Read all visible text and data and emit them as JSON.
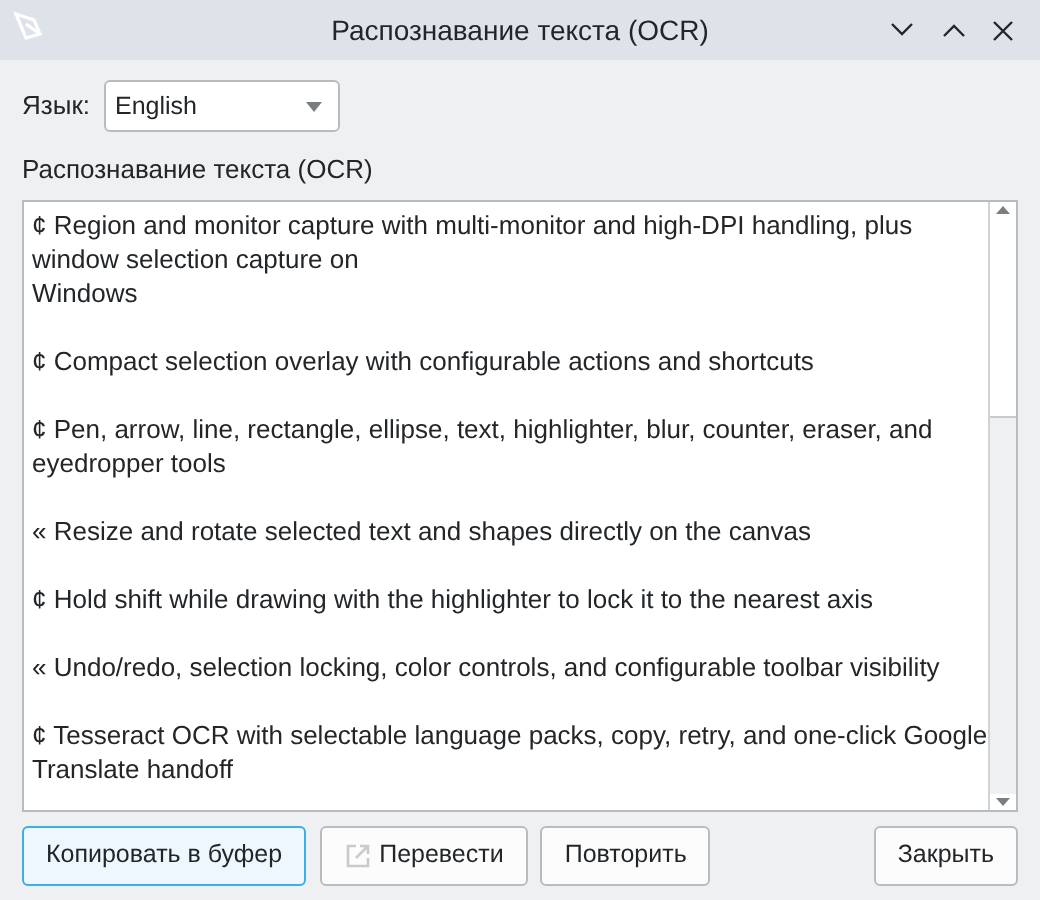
{
  "window": {
    "title": "Распознавание текста (OCR)"
  },
  "language": {
    "label": "Язык:",
    "value": "English"
  },
  "result": {
    "label": "Распознавание текста (OCR)",
    "paragraphs": [
      {
        "lines": [
          "¢ Region and monitor capture with multi-monitor and high-DPI handling, plus",
          "window selection capture on",
          "Windows"
        ]
      },
      {
        "lines": [
          "¢ Compact selection overlay with configurable actions and shortcuts"
        ]
      },
      {
        "lines": [
          "¢ Pen, arrow, line, rectangle, ellipse, text, highlighter, blur, counter, eraser, and",
          "eyedropper tools"
        ]
      },
      {
        "lines": [
          "« Resize and rotate selected text and shapes directly on the canvas"
        ]
      },
      {
        "lines": [
          "¢ Hold shift while drawing with the highlighter to lock it to the nearest axis"
        ]
      },
      {
        "lines": [
          "« Undo/redo, selection locking, color controls, and configurable toolbar visibility"
        ]
      },
      {
        "lines": [
          "¢ Tesseract OCR with selectable language packs, copy, retry, and one-click Google",
          "Translate handoff"
        ]
      }
    ]
  },
  "buttons": [
    {
      "label": "Копировать в буфер",
      "focused": true,
      "icon": false
    },
    {
      "label": "Перевести",
      "focused": false,
      "icon": true
    },
    {
      "label": "Повторить",
      "focused": false,
      "icon": false
    },
    {
      "label": "Закрыть",
      "focused": false,
      "icon": false
    }
  ]
}
